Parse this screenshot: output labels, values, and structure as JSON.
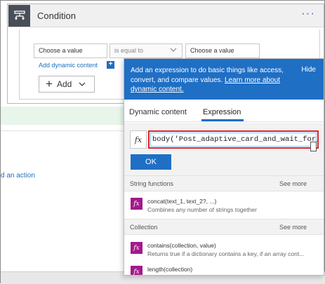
{
  "condition": {
    "title": "Condition",
    "menu_dots": "···",
    "field_left": "Choose a value",
    "operator": "is equal to",
    "field_right": "Choose a value",
    "add_dynamic_label": "Add dynamic content",
    "add_button_label": "Add"
  },
  "designer": {
    "add_action_label": "d an action"
  },
  "popup": {
    "banner_text": "Add an expression to do basic things like access, convert, and compare values.",
    "banner_link": "Learn more about dynamic content.",
    "hide_label": "Hide",
    "tabs": {
      "dynamic": "Dynamic content",
      "expression": "Expression"
    },
    "fx_symbol": "fx",
    "expression_value": "body('Post_adaptive_card_and_wait_for_a",
    "ok_label": "OK",
    "sections": {
      "string": {
        "title": "String functions",
        "see_more": "See more"
      },
      "collection": {
        "title": "Collection",
        "see_more": "See more"
      }
    },
    "functions": [
      {
        "name": "concat(text_1, text_2?, ...)",
        "desc": "Combines any number of strings together"
      },
      {
        "name": "contains(collection, value)",
        "desc": "Returns true if a dictionary contains a key, if an array cont..."
      },
      {
        "name": "length(collection)",
        "desc": ""
      }
    ]
  },
  "colors": {
    "accent": "#1f6fc5",
    "function_badge": "#a4198c",
    "highlight_box": "#e0242a"
  }
}
